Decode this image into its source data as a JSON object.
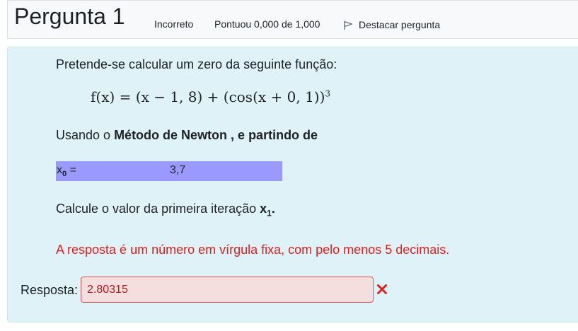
{
  "header": {
    "question_word": "Pergunta",
    "question_number": "1",
    "state": "Incorreto",
    "grade": "Pontuou 0,000 de 1,000",
    "flag_label": "Destacar pergunta"
  },
  "question": {
    "intro": "Pretende-se calcular um zero da seguinte função:",
    "formula": {
      "lhs": "f(x)",
      "rhs": "= (x − 1, 8) + (cos(x + 0, 1))",
      "exponent": "3"
    },
    "method_prefix": "Usando o ",
    "method_bold": "Método de Newton , e partindo de",
    "x0_symbol": "x",
    "x0_sub": "0",
    "x0_eq": " =",
    "x0_value": "3,7",
    "calc_prefix": "Calcule o valor da primeira iteração ",
    "calc_symbol": "x",
    "calc_sub": "1",
    "calc_suffix": ".",
    "warning": "A resposta é um número em vírgula fixa, com pelo menos 5 decimais."
  },
  "answer": {
    "label": "Resposta:",
    "value": "2.80315"
  },
  "colors": {
    "header_bg": "#f8f9fa",
    "content_bg": "#def2f8",
    "x0_highlight": "#9999ff",
    "warning_text": "#e21d1d",
    "input_error_bg": "#f4dede",
    "input_error_border": "#e45050",
    "incorrect_icon": "#e02020"
  },
  "icons": {
    "flag": "flag-icon",
    "incorrect": "cross-icon"
  }
}
